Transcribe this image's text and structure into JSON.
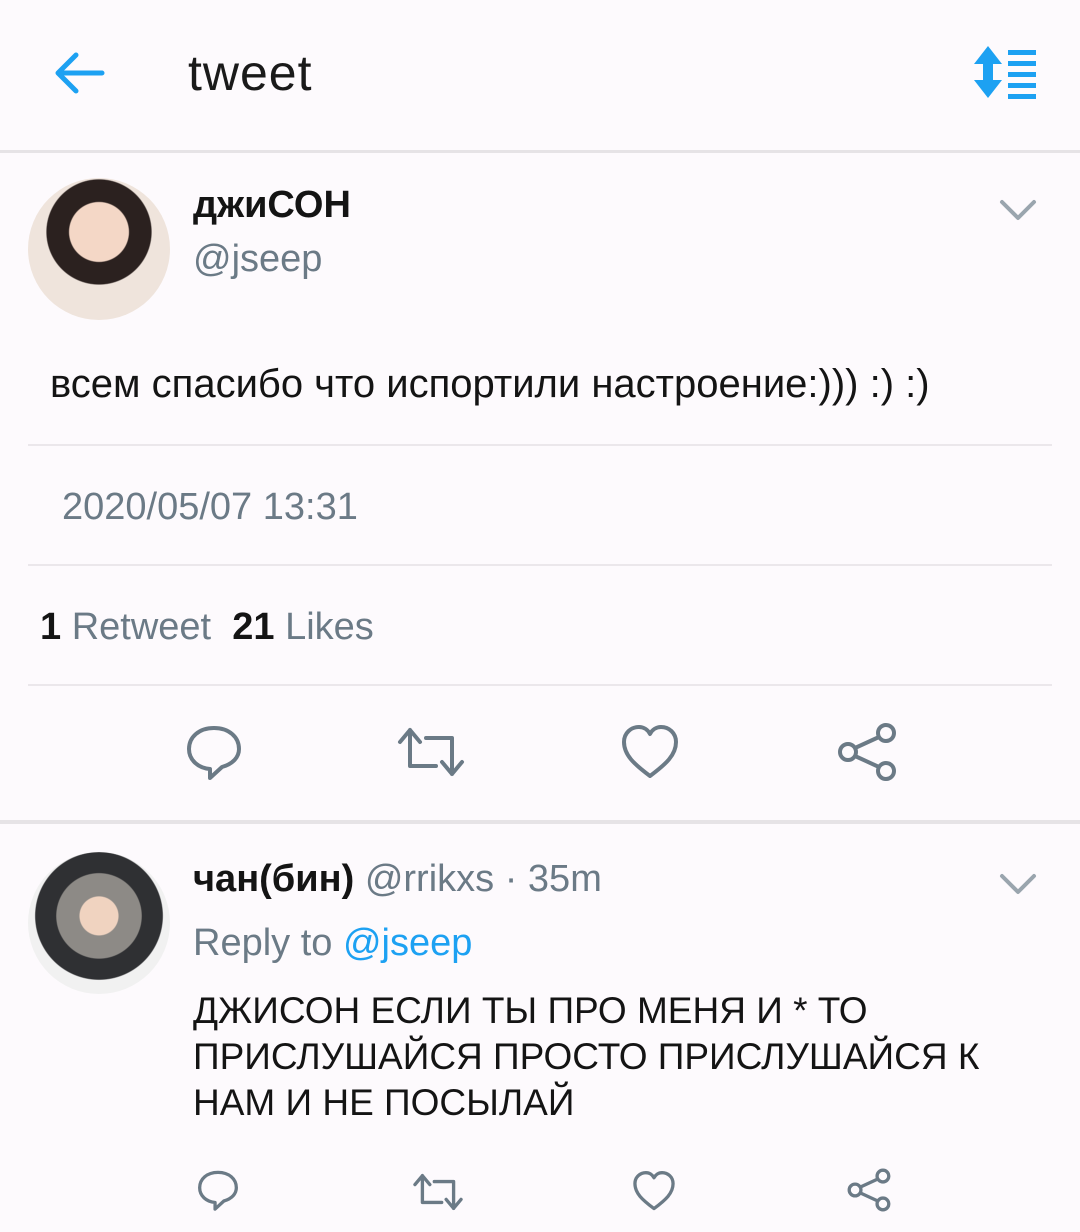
{
  "header": {
    "title": "tweet"
  },
  "tweet": {
    "author_name": "джиСОН",
    "author_handle": "@jseep",
    "text": "всем спасибо что испортили настроение:))) :) :)",
    "timestamp": "2020/05/07 13:31",
    "retweet_count": "1",
    "retweet_label": "Retweet",
    "like_count": "21",
    "like_label": "Likes"
  },
  "reply": {
    "author_name": "чан(бин)",
    "author_handle": "@rrikxs",
    "separator": "·",
    "age": "35m",
    "reply_to_label": "Reply to",
    "reply_to_handle": "@jseep",
    "text": "ДЖИСОН ЕСЛИ ТЫ ПРО МЕНЯ И * ТО ПРИСЛУШАЙСЯ ПРОСТО ПРИСЛУШАЙСЯ К НАМ И НЕ ПОСЫЛАЙ"
  },
  "colors": {
    "accent": "#1da1f2",
    "secondary_text": "#6b7a86",
    "primary_text": "#141414",
    "background": "#fdfafd"
  }
}
